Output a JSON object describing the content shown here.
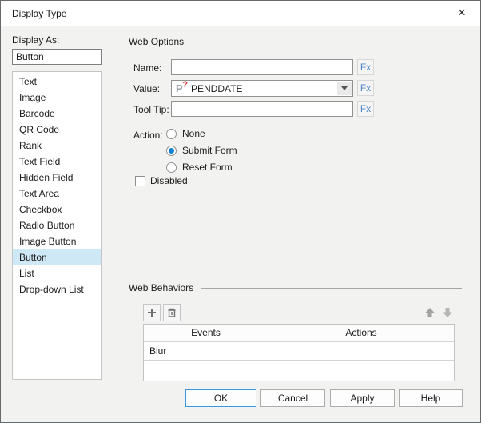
{
  "window": {
    "title": "Display Type",
    "close_icon": "×"
  },
  "display_as": {
    "label": "Display As:",
    "value": "Button",
    "items": [
      "Text",
      "Image",
      "Barcode",
      "QR Code",
      "Rank",
      "Text Field",
      "Hidden Field",
      "Text Area",
      "Checkbox",
      "Radio Button",
      "Image Button",
      "Button",
      "List",
      "Drop-down List"
    ],
    "selected_index": 11,
    "selected_item": "Button"
  },
  "web_options": {
    "title": "Web Options",
    "fx_label": "Fx",
    "name": {
      "label": "Name:",
      "value": ""
    },
    "value": {
      "label": "Value:",
      "selected": "PENDDATE",
      "icon": "parameter-icon"
    },
    "tooltip": {
      "label": "Tool Tip:",
      "value": ""
    },
    "action": {
      "label": "Action:",
      "options": [
        {
          "label": "None",
          "selected": false
        },
        {
          "label": "Submit Form",
          "selected": true
        },
        {
          "label": "Reset Form",
          "selected": false
        }
      ]
    },
    "disabled": {
      "label": "Disabled",
      "checked": false
    }
  },
  "web_behaviors": {
    "title": "Web Behaviors",
    "toolbar": {
      "add": "add",
      "delete": "delete",
      "move_up": "move-up",
      "move_down": "move-down"
    },
    "table": {
      "columns": [
        "Events",
        "Actions"
      ],
      "rows": [
        {
          "event": "Blur",
          "action": ""
        }
      ]
    }
  },
  "footer": {
    "ok": "OK",
    "cancel": "Cancel",
    "apply": "Apply",
    "help": "Help"
  },
  "colors": {
    "selection_bg": "#cfe8f6",
    "accent_blue": "#1083d6",
    "fx_link": "#4a86c8",
    "default_button_border": "#3a96dd",
    "dialog_bg": "#f2f3f1"
  }
}
